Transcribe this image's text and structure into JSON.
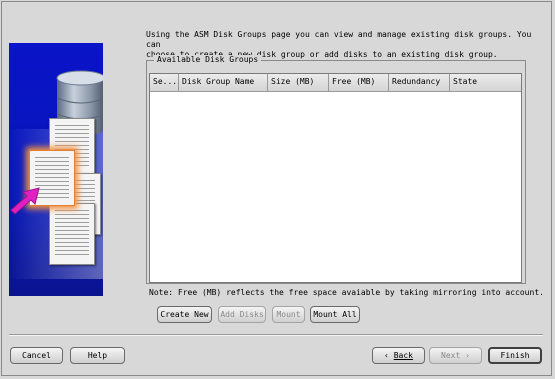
{
  "intro": {
    "line1": "Using the ASM Disk Groups page you can view and manage existing disk groups. You can",
    "line2": "choose to create a new disk group or add disks to an existing disk group."
  },
  "disk_groups": {
    "title": "Available Disk Groups",
    "columns": [
      "Se...",
      "Disk Group Name",
      "Size (MB)",
      "Free (MB)",
      "Redundancy",
      "State"
    ],
    "rows": []
  },
  "note": "Note: Free (MB) reflects the free space avaiable by taking mirroring into account.",
  "actions": {
    "create_new": "Create New",
    "add_disks": "Add Disks",
    "mount": "Mount",
    "mount_all": "Mount All"
  },
  "footer": {
    "cancel": "Cancel",
    "help": "Help",
    "back": "Back",
    "next": "Next",
    "finish": "Finish"
  },
  "icons": [
    "database-icon",
    "document-icon",
    "arrow-icon",
    "back-arrow-icon",
    "next-arrow-icon"
  ],
  "colors": {
    "illustration_bg": "#0a14c8",
    "arrow": "#e020c0",
    "glow": "#f39040"
  }
}
